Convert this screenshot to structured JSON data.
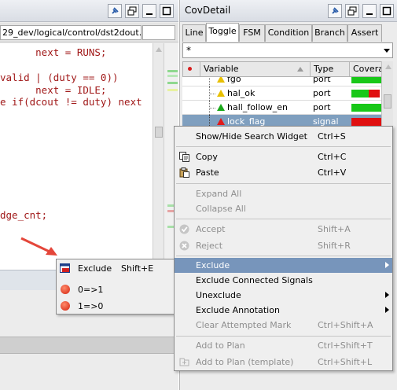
{
  "left_panel": {
    "file_path": "29_dev/logical/control/dst2dout.",
    "code_lines": [
      {
        "text": "      next = RUNS;"
      },
      {
        "text": ""
      },
      {
        "text": "valid | (duty == 0))"
      },
      {
        "text": "      next = IDLE;"
      },
      {
        "text": "e if(dcout != duty) next"
      },
      {
        "text": ""
      },
      {
        "text": ""
      },
      {
        "text": ""
      },
      {
        "text": ""
      },
      {
        "text": ""
      },
      {
        "text": ""
      },
      {
        "text": ""
      },
      {
        "text": "dge_cnt;"
      }
    ]
  },
  "right_panel": {
    "title": "CovDetail",
    "tabs": [
      "Line",
      "Toggle",
      "FSM",
      "Condition",
      "Branch",
      "Assert"
    ],
    "active_tab": "Toggle",
    "filter_value": "*",
    "columns": [
      "Variable",
      "Type",
      "Covera"
    ],
    "rows": [
      {
        "name": "fgo",
        "type": "port",
        "marker": "yellow-triangle",
        "cov_green": 0.95,
        "cov_red": 0.0
      },
      {
        "name": "hal_ok",
        "type": "port",
        "marker": "yellow-triangle",
        "cov_green": 0.55,
        "cov_red": 0.35
      },
      {
        "name": "hall_follow_en",
        "type": "port",
        "marker": "green-triangle",
        "cov_green": 0.95,
        "cov_red": 0.0
      },
      {
        "name": "lock_flag",
        "type": "signal",
        "marker": "red-triangle",
        "cov_green": 0.0,
        "cov_red": 0.95
      }
    ]
  },
  "exclude_menu": {
    "items": [
      {
        "label": "Exclude",
        "mnemonic": "E",
        "shortcut": "Shift+E",
        "icon": "exclude-icon"
      },
      {
        "label": "0=>1",
        "mnemonic": "0",
        "icon": "red-dot-icon"
      },
      {
        "label": "1=>0",
        "mnemonic": "1",
        "icon": "red-dot-icon"
      }
    ]
  },
  "context_menu": {
    "items": [
      {
        "label": "Show/Hide Search Widget",
        "mnemonic": "S",
        "shortcut": "Ctrl+S",
        "disabled": false
      },
      {
        "label": "Copy",
        "mnemonic": "C",
        "shortcut": "Ctrl+C",
        "disabled": false,
        "icon": "copy-icon"
      },
      {
        "label": "Paste",
        "mnemonic": "P",
        "shortcut": "Ctrl+V",
        "disabled": false,
        "icon": "paste-icon"
      },
      {
        "label": "Expand All",
        "mnemonic": "E",
        "shortcut": "",
        "disabled": true
      },
      {
        "label": "Collapse All",
        "mnemonic": "o",
        "shortcut": "",
        "disabled": true
      },
      {
        "label": "Accept",
        "mnemonic": "A",
        "shortcut": "Shift+A",
        "disabled": true,
        "icon": "check-icon"
      },
      {
        "label": "Reject",
        "mnemonic": "R",
        "shortcut": "Shift+R",
        "disabled": true,
        "icon": "reject-icon"
      },
      {
        "label": "Exclude",
        "mnemonic": "E",
        "shortcut": "",
        "disabled": false,
        "submenu": true,
        "highlighted": true
      },
      {
        "label": "Exclude Connected Signals",
        "mnemonic": "x",
        "shortcut": "",
        "disabled": false
      },
      {
        "label": "Unexclude",
        "mnemonic": "U",
        "shortcut": "",
        "disabled": false,
        "submenu": true
      },
      {
        "label": "Exclude Annotation",
        "mnemonic": "e",
        "shortcut": "",
        "disabled": false,
        "submenu": true
      },
      {
        "label": "Clear Attempted Mark",
        "mnemonic": "C",
        "shortcut": "Ctrl+Shift+A",
        "disabled": true
      },
      {
        "label": "Add to Plan",
        "mnemonic": "t",
        "shortcut": "Ctrl+Shift+T",
        "disabled": true
      },
      {
        "label": "Add to Plan (template)",
        "mnemonic": "t",
        "shortcut": "Ctrl+Shift+L",
        "disabled": true,
        "icon": "template-icon"
      }
    ]
  }
}
